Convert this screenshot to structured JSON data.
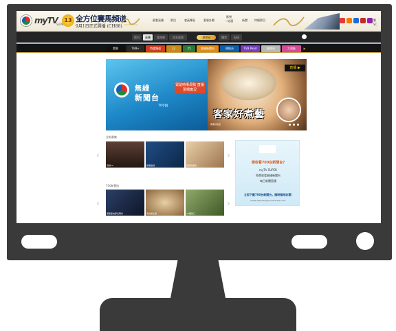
{
  "header": {
    "brand": "myTV",
    "brand_super": "SUPER",
    "anniversary": "13",
    "promo_line1": "全方位賽馬頻道",
    "promo_line2": "9月1日正式開播 (CH88)",
    "nav": [
      "觀看直播",
      "節目",
      "會員專區",
      "套餐計劃",
      "影視\n一站通",
      "新聞",
      "特備節目"
    ],
    "social_colors": [
      "#e53935",
      "#f57c00",
      "#1e6ad6",
      "#c62828",
      "#8e24aa"
    ],
    "tail_label": "繁SC"
  },
  "toolbar": {
    "tabs": [
      "節目",
      "直播",
      "電視劇",
      "綜合娛樂",
      "體育",
      "紀錄"
    ],
    "active_index": 1,
    "pill_label": "翡翠台"
  },
  "channel_strip": {
    "tabs": [
      "翡翠",
      "TVB+",
      "特選頻道",
      "J2",
      "25",
      "無綫新聞台",
      "明珠台",
      "TVB Pearl",
      "經典台",
      "大灣區"
    ],
    "colors": [
      "#111111",
      "#2a2a2a",
      "#d23b1e",
      "#c58a1a",
      "#2b7a3b",
      "#e08a1a",
      "#0f5ea8",
      "#7a3cc4",
      "#b8b8b8",
      "#d64a9a"
    ]
  },
  "hero": {
    "title_line1": "無綫",
    "title_line2": "新聞台",
    "channel_no": "700台",
    "tagline": "緊貼時事局勢 直播現場實況",
    "live_label": "直播 ▶",
    "calligraphy": "客家好煮藝",
    "caption": "客家好煮藝",
    "colors": {
      "news_blue": "#1e88c8",
      "live_yellow": "#ffd300"
    }
  },
  "sections": [
    {
      "title": "全新劇集",
      "items": [
        {
          "caption": "刑偵12",
          "color": "#3a2a26"
        },
        {
          "caption": "新聞透視",
          "color": "#1f4d85"
        },
        {
          "caption": "我們的愛情",
          "color": "#d0a97a"
        }
      ]
    },
    {
      "title": "700新聞台",
      "items": [
        {
          "caption": "萬聖節的夢幻時代",
          "color": "#1d2d4c"
        },
        {
          "caption": "美食關注組",
          "color": "#a57a4a"
        },
        {
          "caption": "32國第三",
          "color": "#5b7d3a"
        }
      ]
    }
  ],
  "side_ad": {
    "line1": "想收看700台新聞台?",
    "line2": "myTV SUPER",
    "line3": "免費收看無綫新聞台",
    "line4": "每日新聞直播",
    "footer1": "立即下載700台新聞台，隨時隨地收看!",
    "footer2": "https://aboutmytv.mytvsuper.com"
  }
}
